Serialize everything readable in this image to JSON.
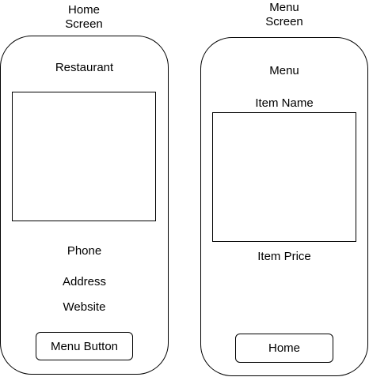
{
  "home_screen": {
    "title_line1": "Home",
    "title_line2": "Screen",
    "heading": "Restaurant",
    "phone": "Phone",
    "address": "Address",
    "website": "Website",
    "button_label": "Menu Button"
  },
  "menu_screen": {
    "title_line1": "Menu",
    "title_line2": "Screen",
    "heading": "Menu",
    "item_name": "Item Name",
    "item_price": "Item Price",
    "button_label": "Home"
  }
}
